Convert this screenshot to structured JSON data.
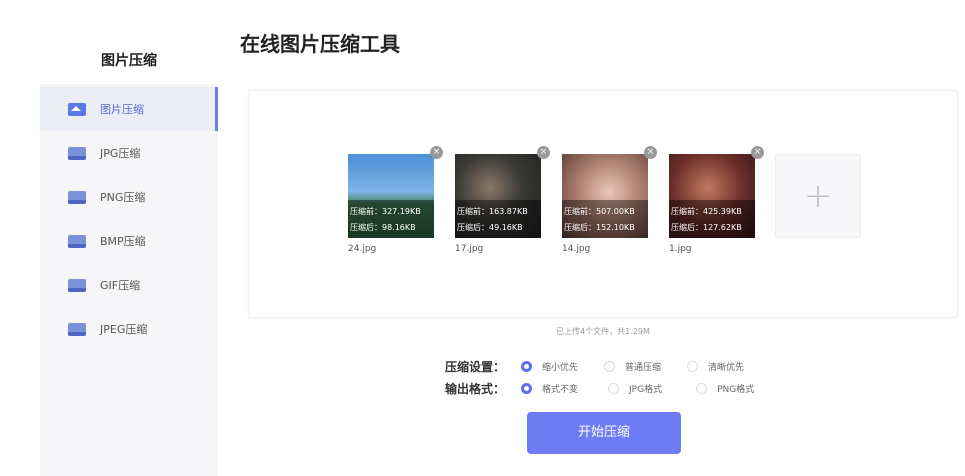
{
  "sidebar": {
    "title": "图片压缩",
    "items": [
      {
        "label": "图片压缩",
        "icon": "image-icon"
      },
      {
        "label": "JPG压缩",
        "icon": "jpg-file-icon"
      },
      {
        "label": "PNG压缩",
        "icon": "png-file-icon"
      },
      {
        "label": "BMP压缩",
        "icon": "bmp-file-icon"
      },
      {
        "label": "GIF压缩",
        "icon": "gif-file-icon"
      },
      {
        "label": "JPEG压缩",
        "icon": "jpeg-file-icon"
      }
    ]
  },
  "page": {
    "title": "在线图片压缩工具"
  },
  "files": [
    {
      "name": "24.jpg",
      "before": "压缩前：327.19KB",
      "after": "压缩后：98.16KB",
      "close": "×"
    },
    {
      "name": "17.jpg",
      "before": "压缩前：163.87KB",
      "after": "压缩后：49.16KB",
      "close": "×"
    },
    {
      "name": "14.jpg",
      "before": "压缩前：507.00KB",
      "after": "压缩后：152.10KB",
      "close": "×"
    },
    {
      "name": "1.jpg",
      "before": "压缩前：425.39KB",
      "after": "压缩后：127.62KB",
      "close": "×"
    }
  ],
  "add_label": "+",
  "upload_status": "已上传4个文件，共1.29M",
  "settings": {
    "compression": {
      "label": "压缩设置：",
      "options": [
        "缩小优先",
        "普通压缩",
        "清晰优先"
      ],
      "selected": "缩小优先"
    },
    "format": {
      "label": "输出格式：",
      "options": [
        "格式不变",
        "JPG格式",
        "PNG格式"
      ],
      "selected": "格式不变"
    }
  },
  "start_button": "开始压缩",
  "colors": {
    "accent": "#6d7cf3",
    "active_nav_bg": "#eceef5"
  }
}
